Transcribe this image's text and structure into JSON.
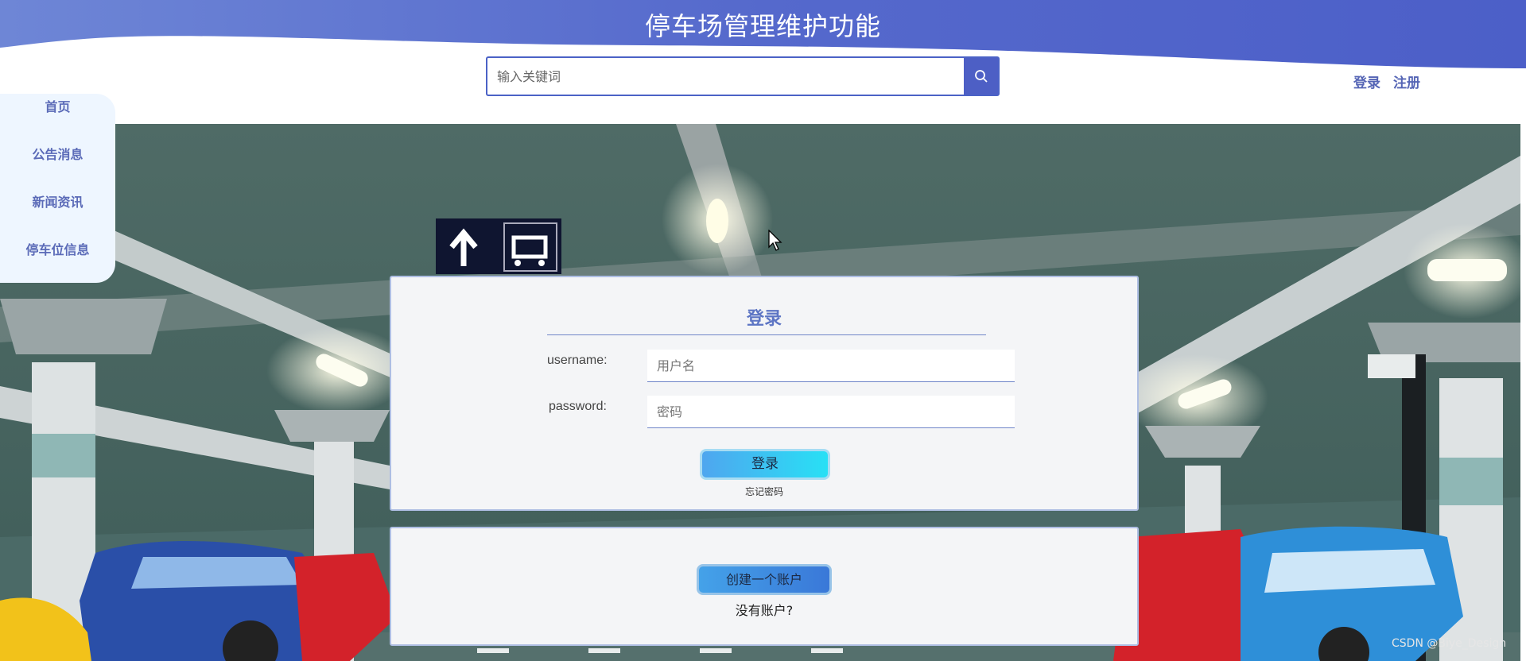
{
  "header": {
    "title": "停车场管理维护功能",
    "search": {
      "placeholder": "输入关键词",
      "value": ""
    },
    "search_icon": "search-icon",
    "login_link": "登录",
    "register_link": "注册"
  },
  "sidebar": {
    "items": [
      {
        "label": "首页"
      },
      {
        "label": "公告消息"
      },
      {
        "label": "新闻资讯"
      },
      {
        "label": "停车位信息"
      }
    ]
  },
  "login_form": {
    "title": "登录",
    "username_label": "username:",
    "username_placeholder": "用户名",
    "password_label": "password:",
    "password_placeholder": "密码",
    "submit_label": "登录",
    "forgot_label": "忘记密码"
  },
  "register": {
    "button_label": "创建一个账户",
    "hint": "没有账户?"
  },
  "watermark": "CSDN @Biye_Design",
  "colors": {
    "header_blue": "#4d5fc5",
    "link_blue": "#5565b5",
    "button_cyan": "#28e0f5"
  }
}
